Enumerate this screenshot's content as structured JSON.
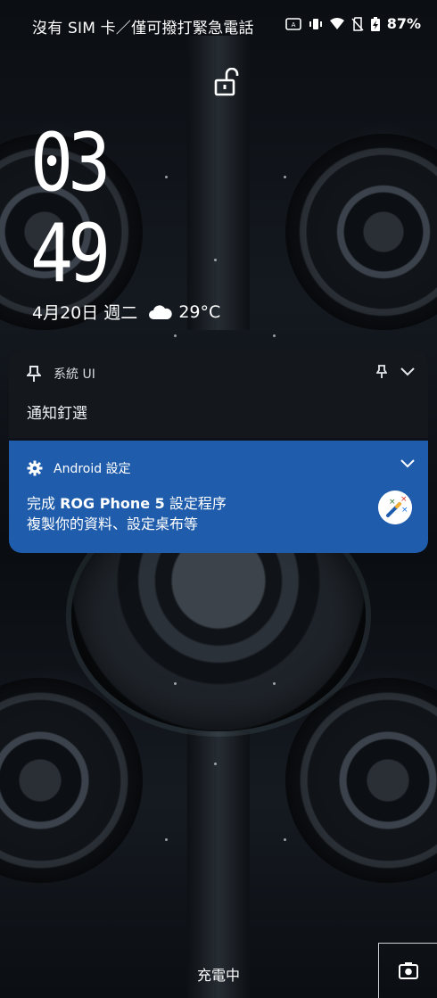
{
  "status_bar": {
    "carrier_text": "沒有 SIM 卡／僅可撥打緊急電話",
    "battery_percent": "87%",
    "icons": [
      "auto-brightness-icon",
      "vibrate-icon",
      "wifi-icon",
      "no-sim-icon",
      "battery-charging-icon"
    ]
  },
  "lockscreen": {
    "lock_icon": "unlocked-padlock-icon",
    "clock_hours": "03",
    "clock_minutes": "49",
    "date": "4月20日 週二",
    "weather_icon": "cloud-icon",
    "temperature": "29°C"
  },
  "notifications": [
    {
      "app_name": "系統 UI",
      "app_icon": "pin-icon",
      "title": "通知釘選",
      "background": "#14171c"
    },
    {
      "app_name": "Android 設定",
      "app_icon": "gear-icon",
      "title_prefix": "完成",
      "title_bold": "ROG Phone 5",
      "title_suffix": "設定程序",
      "text": "複製你的資料、設定桌布等",
      "large_icon": "magic-wand-icon",
      "background": "#1f5cac"
    }
  ],
  "bottom": {
    "status_text": "充電中",
    "camera_icon": "camera-icon"
  }
}
